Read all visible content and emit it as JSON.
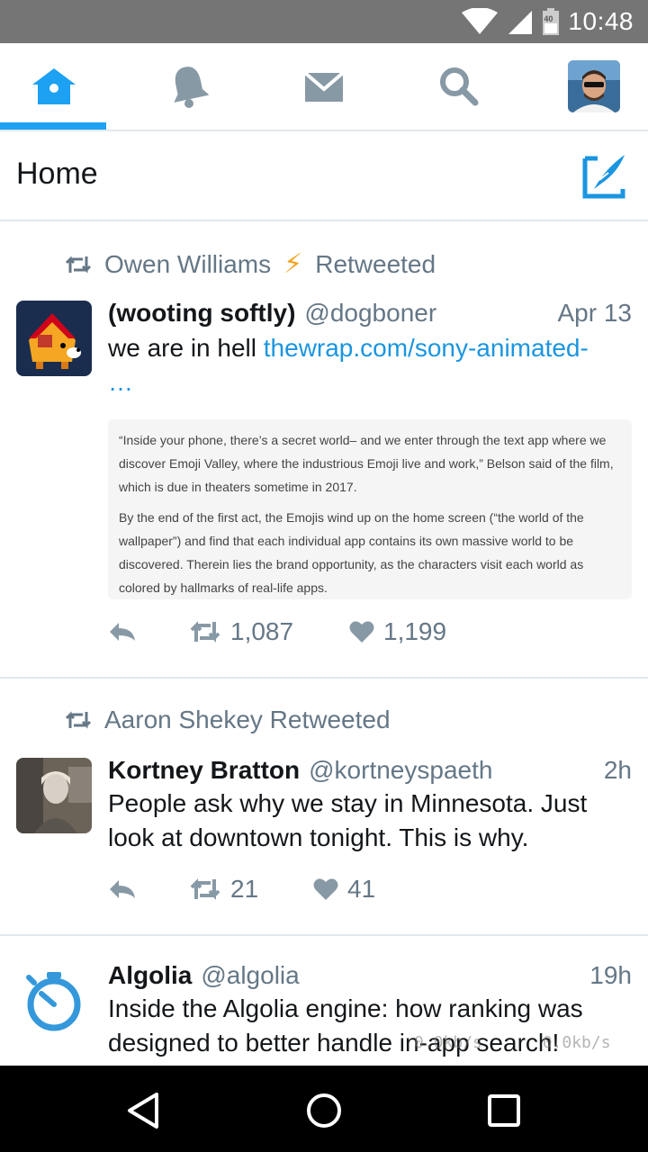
{
  "status_bar": {
    "time": "10:48",
    "battery_level": "40"
  },
  "nav_tabs": [
    {
      "name": "home",
      "icon": "home-icon",
      "active": true
    },
    {
      "name": "notifications",
      "icon": "bell-icon",
      "active": false
    },
    {
      "name": "messages",
      "icon": "envelope-icon",
      "active": false
    },
    {
      "name": "search",
      "icon": "search-icon",
      "active": false
    },
    {
      "name": "profile",
      "icon": "avatar",
      "active": false
    }
  ],
  "header": {
    "title": "Home"
  },
  "tweets": [
    {
      "retweeted_by": "Owen Williams",
      "retweeted_emoji": "⚡",
      "retweeted_label": "Retweeted",
      "name": "(wooting softly)",
      "handle": "@dogboner",
      "date": "Apr 13",
      "text": "we are in hell ",
      "link": "thewrap.com/sony-animated-\n…",
      "quote_paragraph_1": "“Inside your phone, there’s a secret world– and we enter through the text app where we discover Emoji Valley, where the industrious Emoji live and work,” Belson said of the film, which is due in theaters sometime in 2017.",
      "quote_paragraph_2": "By the end of the first act, the Emojis wind up on the home screen (“the world of the wallpaper”) and find that each individual app contains its own massive world to be discovered. Therein lies the brand opportunity, as the characters visit each world as colored by hallmarks of real-life apps.",
      "retweets": "1,087",
      "likes": "1,199"
    },
    {
      "retweeted_by": "Aaron Shekey Retweeted",
      "name": "Kortney Bratton",
      "handle": "@kortneyspaeth",
      "date": "2h",
      "text": "People ask why we stay in Minnesota. Just look at downtown tonight. This is why.",
      "retweets": "21",
      "likes": "41"
    },
    {
      "name": "Algolia",
      "handle": "@algolia",
      "date": "19h",
      "text": "Inside the Algolia engine: how ranking was designed to better handle in-app search!"
    }
  ],
  "network_speed": {
    "down": "0.0kb/s",
    "up": "0.0kb/s"
  },
  "colors": {
    "accent": "#1da1f2",
    "muted": "#657786",
    "link": "#1b95e0",
    "statusbar": "#757575"
  }
}
